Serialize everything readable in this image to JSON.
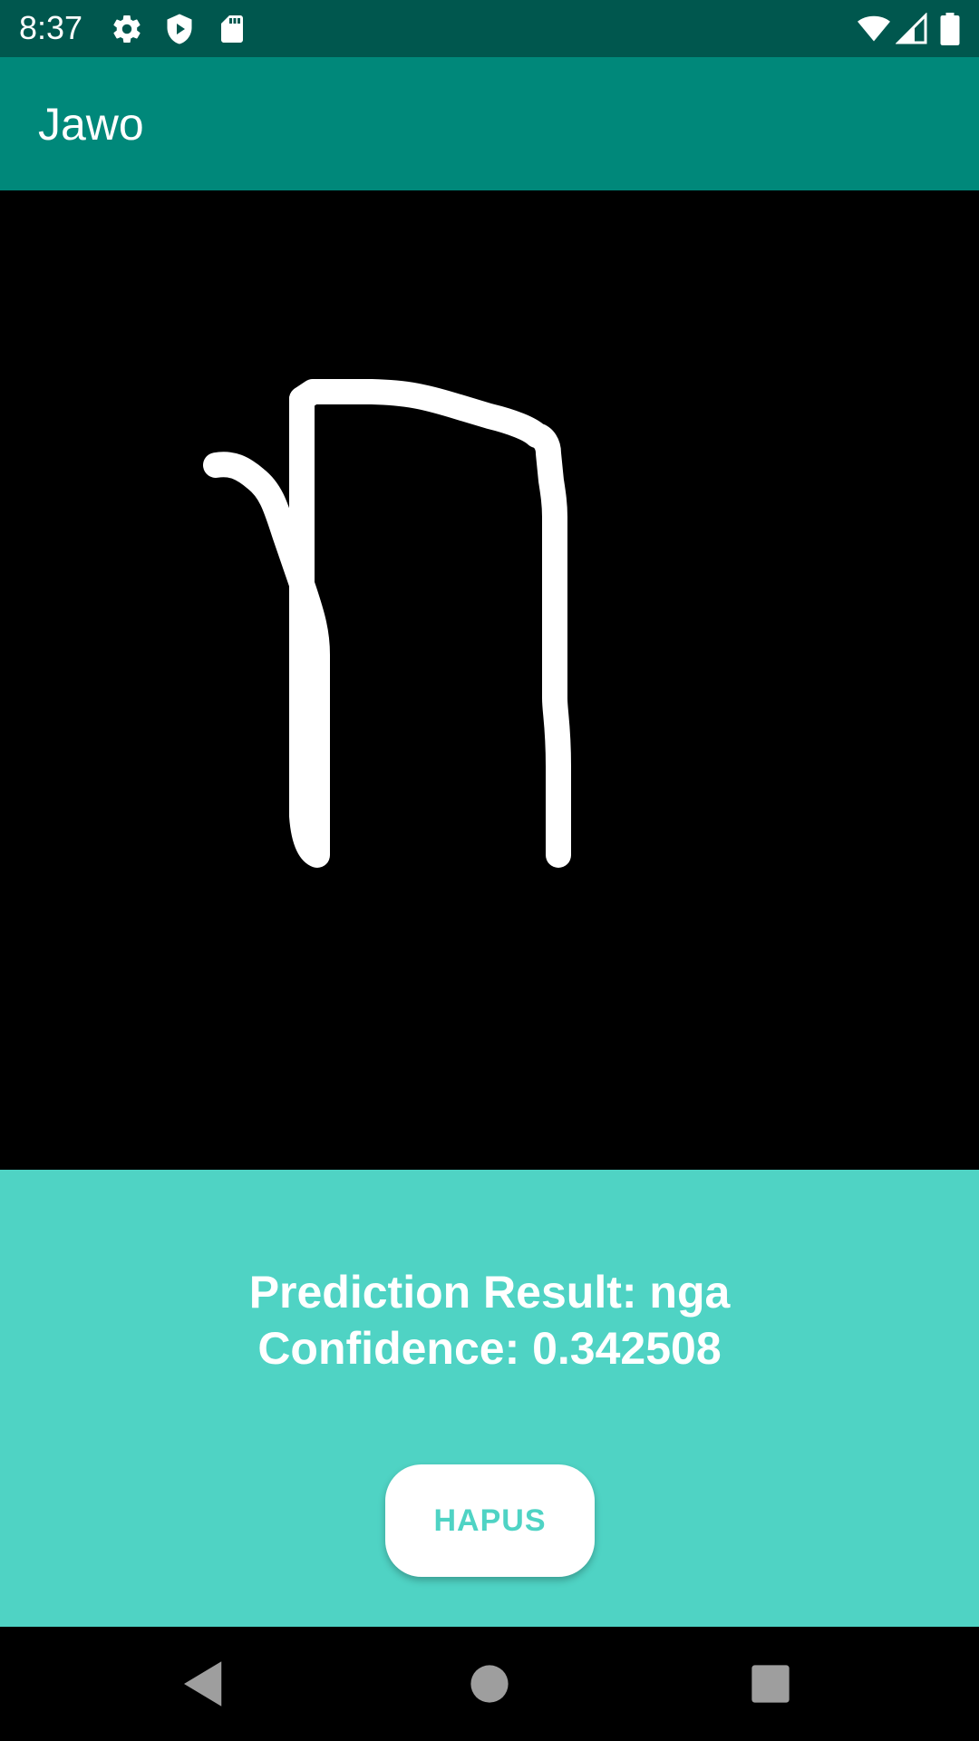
{
  "status_bar": {
    "time": "8:37",
    "icons_left": [
      "settings-icon",
      "shield-icon",
      "sd-card-icon"
    ],
    "icons_right": [
      "wifi-icon",
      "signal-icon",
      "battery-icon"
    ]
  },
  "app_bar": {
    "title": "Jawo",
    "color": "#00887A",
    "status_color": "#00574E"
  },
  "canvas": {
    "background": "#000000",
    "stroke_color": "#FFFFFF"
  },
  "result": {
    "prediction_line": "Prediction Result: nga",
    "confidence_line": "Confidence: 0.342508",
    "panel_color": "#4FD3C4"
  },
  "actions": {
    "clear_label": "HAPUS"
  },
  "nav_bar": {
    "buttons": [
      "back-icon",
      "home-icon",
      "recents-icon"
    ]
  }
}
